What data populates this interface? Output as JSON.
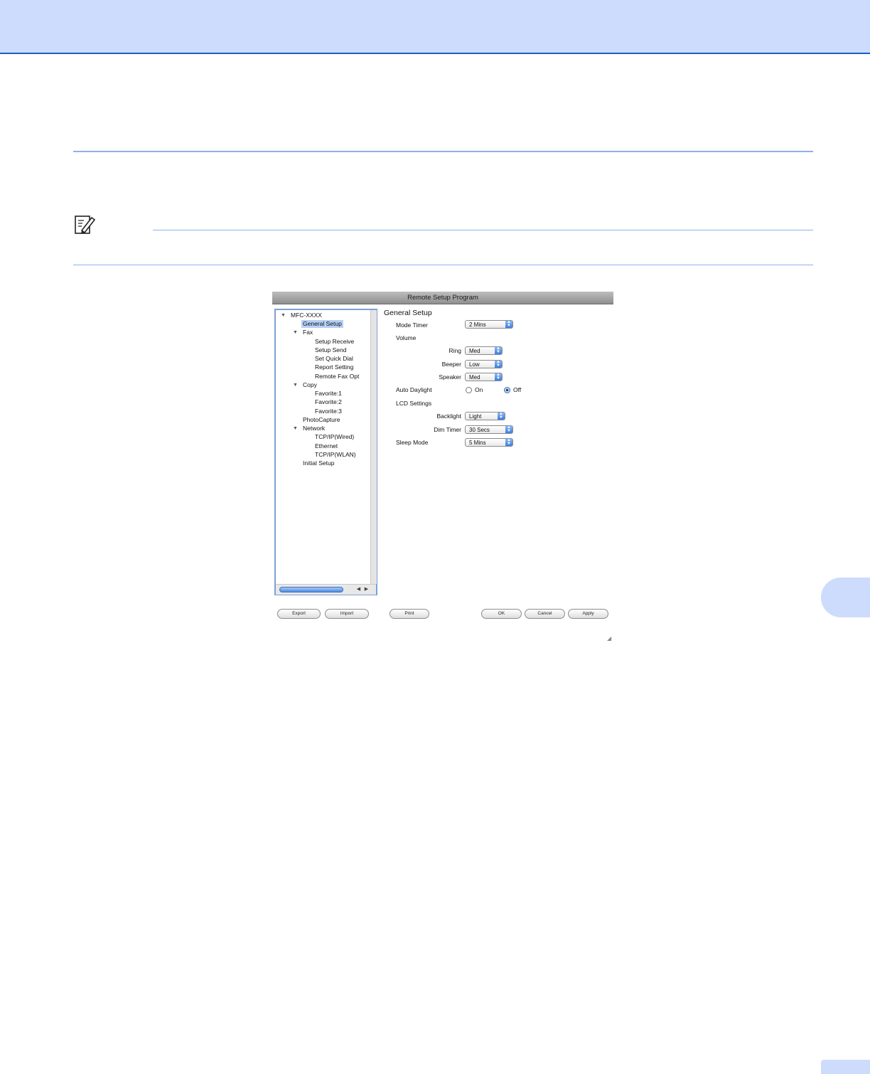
{
  "window": {
    "title": "Remote Setup Program"
  },
  "tree": {
    "items": [
      {
        "label": "MFC-XXXX",
        "expanded": true
      },
      {
        "label": "General Setup",
        "selected": true
      },
      {
        "label": "Fax",
        "expanded": true
      },
      {
        "label": "Setup Receive"
      },
      {
        "label": "Setup Send"
      },
      {
        "label": "Set Quick Dial"
      },
      {
        "label": "Report Setting"
      },
      {
        "label": "Remote Fax Opt"
      },
      {
        "label": "Copy",
        "expanded": true
      },
      {
        "label": "Favorite:1"
      },
      {
        "label": "Favorite:2"
      },
      {
        "label": "Favorite:3"
      },
      {
        "label": "PhotoCapture"
      },
      {
        "label": "Network",
        "expanded": true
      },
      {
        "label": "TCP/IP(Wired)"
      },
      {
        "label": "Ethernet"
      },
      {
        "label": "TCP/IP(WLAN)"
      },
      {
        "label": "Initial Setup"
      }
    ],
    "expand_glyph": "▼"
  },
  "settings": {
    "title": "General Setup",
    "mode_timer": {
      "label": "Mode Timer",
      "value": "2 Mins"
    },
    "volume": {
      "label": "Volume"
    },
    "ring": {
      "label": "Ring",
      "value": "Med"
    },
    "beeper": {
      "label": "Beeper",
      "value": "Low"
    },
    "speaker": {
      "label": "Speaker",
      "value": "Med"
    },
    "auto_daylight": {
      "label": "Auto Daylight",
      "on_label": "On",
      "off_label": "Off",
      "selected": "Off"
    },
    "lcd": {
      "label": "LCD Settings"
    },
    "backlight": {
      "label": "Backlight",
      "value": "Light"
    },
    "dim_timer": {
      "label": "Dim Timer",
      "value": "30 Secs"
    },
    "sleep_mode": {
      "label": "Sleep Mode",
      "value": "5 Mins"
    }
  },
  "buttons": {
    "export": "Export",
    "import": "Import",
    "print": "Print",
    "ok": "OK",
    "cancel": "Cancel",
    "apply": "Apply"
  },
  "icons": {
    "note": "note-pencil-icon",
    "select_arrow": "updown-arrow-icon",
    "resize": "resize-grip-icon"
  },
  "colors": {
    "header_band": "#cddcfc",
    "header_rule": "#1a5dc9",
    "accent_blue": "#3c7ee0"
  }
}
